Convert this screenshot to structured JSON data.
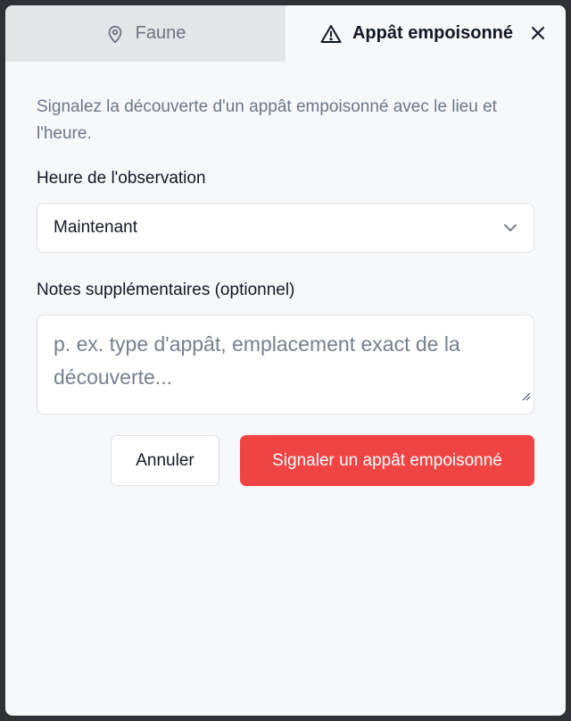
{
  "tabs": [
    {
      "label": "Faune",
      "icon": "map-pin-icon",
      "active": false
    },
    {
      "label": "Appât empoisonné",
      "icon": "warning-triangle-icon",
      "active": true
    }
  ],
  "form": {
    "description": "Signalez la découverte d'un appât empoisonné avec le lieu et l'heure.",
    "time_label": "Heure de l'observation",
    "time_value": "Maintenant",
    "notes_label": "Notes supplémentaires (optionnel)",
    "notes_placeholder": "p. ex. type d'appât, emplacement exact de la découverte..."
  },
  "actions": {
    "cancel_label": "Annuler",
    "submit_label": "Signaler un appât empoisonné"
  },
  "colors": {
    "accent": "#ef4444",
    "muted_text": "#6b7788",
    "inactive_tab": "#e5e6e9"
  }
}
